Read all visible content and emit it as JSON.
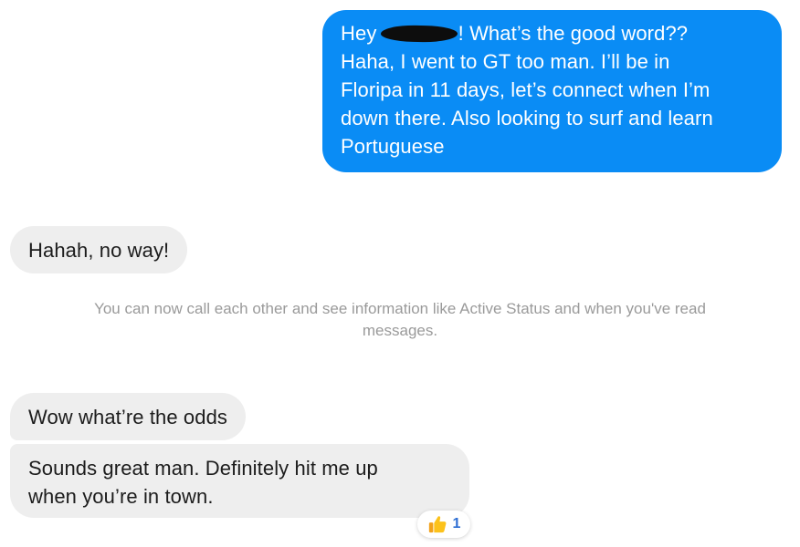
{
  "messages": {
    "outgoing_1": {
      "lines": [
        {
          "before": "Hey ",
          "after": "! What’s the good word??"
        },
        "Haha, I went to GT too man. I’ll be in",
        "Floripa in 11 days, let’s connect when I’m",
        "down there. Also looking to surf and learn",
        "Portuguese"
      ]
    },
    "incoming_1": "Hahah, no way!",
    "incoming_2": "Wow what’re the odds",
    "incoming_3": {
      "lines": [
        "Sounds great man. Definitely hit me up",
        "when you’re in town."
      ]
    }
  },
  "system_note": {
    "lines": [
      "You can now call each other and see information like Active Status and when you've read",
      "messages."
    ]
  },
  "reaction": {
    "icon": "thumbs-up-icon",
    "count": "1"
  },
  "colors": {
    "outgoing_bubble": "#0a8cf5",
    "incoming_bubble": "#eeeeee",
    "system_text": "#9a9a9a",
    "reaction_count": "#2f6fd3"
  }
}
